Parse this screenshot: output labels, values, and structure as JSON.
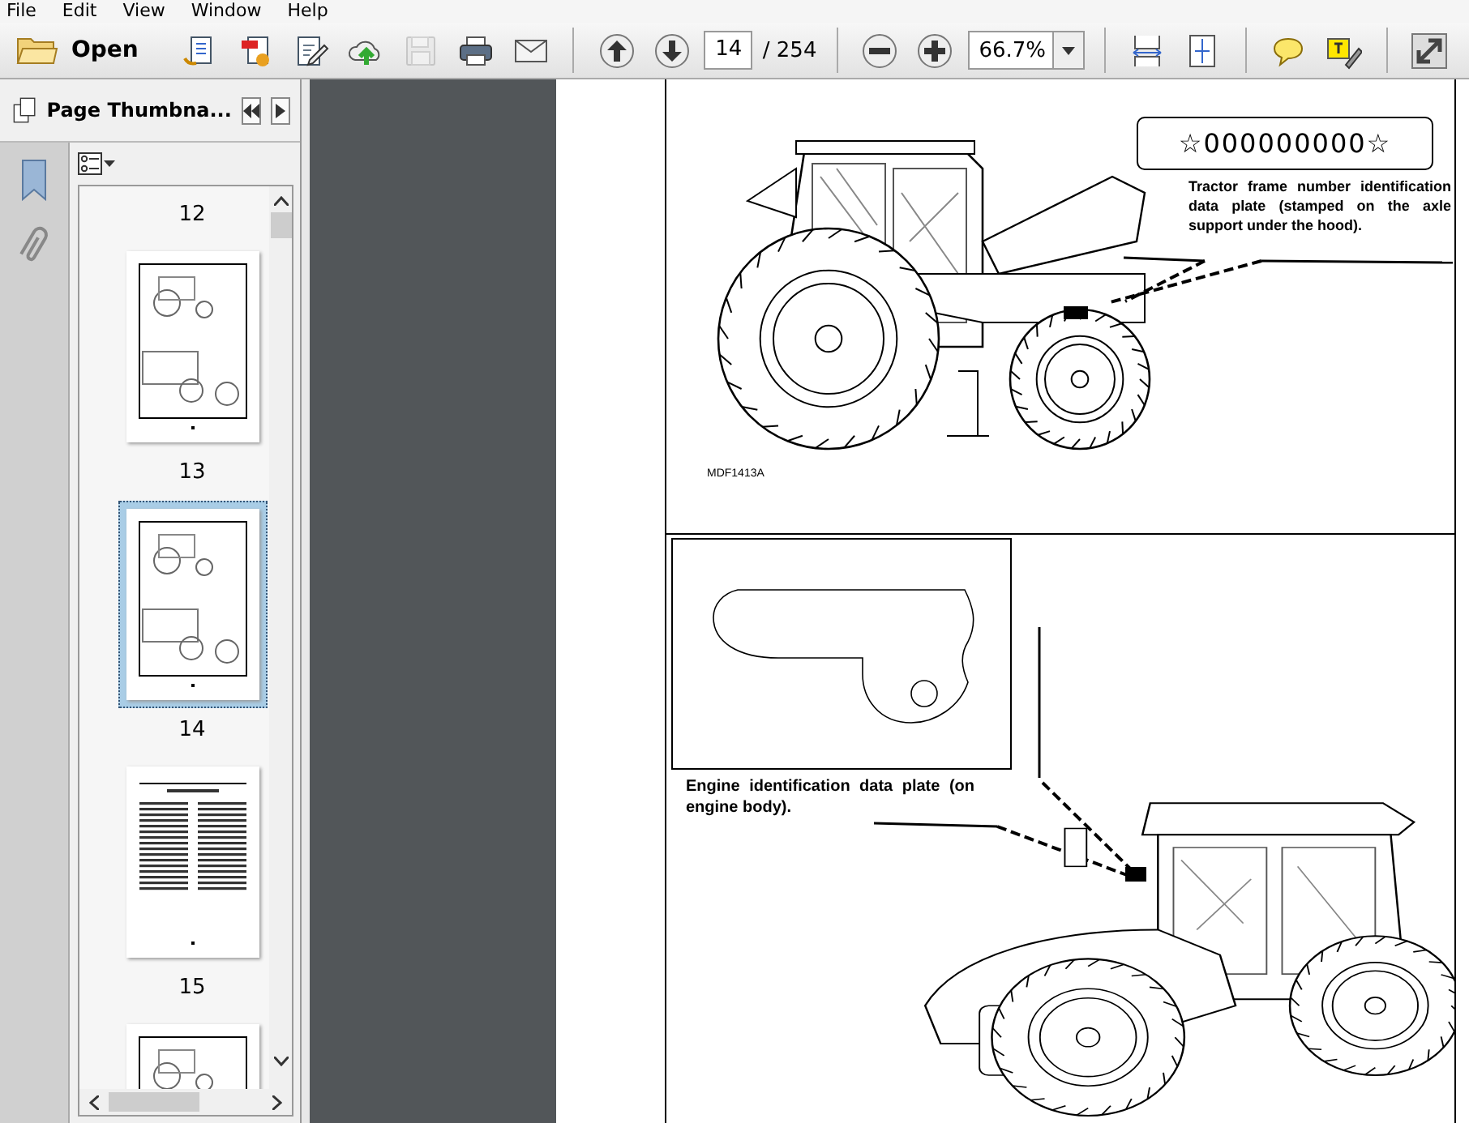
{
  "menu": [
    "File",
    "Edit",
    "View",
    "Window",
    "Help"
  ],
  "toolbar": [
    {
      "kind": "open",
      "label": "Open"
    },
    {
      "kind": "create",
      "disabled": false
    },
    {
      "kind": "convert",
      "disabled": false
    },
    {
      "kind": "edit",
      "disabled": false
    },
    {
      "kind": "upload",
      "disabled": false
    },
    {
      "kind": "save",
      "disabled": true
    },
    {
      "kind": "print",
      "disabled": false
    },
    {
      "kind": "mail",
      "disabled": false
    },
    {
      "kind": "separator"
    },
    {
      "kind": "prev",
      "disabled": false
    },
    {
      "kind": "next",
      "disabled": false
    },
    {
      "kind": "page",
      "value": "14",
      "total": "/ 254"
    },
    {
      "kind": "separator"
    },
    {
      "kind": "zoomout",
      "disabled": false
    },
    {
      "kind": "zoomin",
      "disabled": false
    },
    {
      "kind": "zoom",
      "value": "66.7%"
    },
    {
      "kind": "separator"
    },
    {
      "kind": "fitwidth",
      "disabled": false
    },
    {
      "kind": "fitpage",
      "disabled": false
    },
    {
      "kind": "separator"
    },
    {
      "kind": "comment",
      "disabled": false
    },
    {
      "kind": "highlight",
      "disabled": false
    },
    {
      "kind": "separator"
    },
    {
      "kind": "fullscreen",
      "disabled": false
    }
  ],
  "thumbnails_panel": {
    "title": "Page Thumbna...",
    "items": [
      {
        "kind": "label_only",
        "label": "12",
        "selected": false
      },
      {
        "kind": "figure",
        "label": "13",
        "selected": false
      },
      {
        "kind": "figure",
        "label": "14",
        "selected": true
      },
      {
        "kind": "text",
        "label": "15",
        "selected": false
      },
      {
        "kind": "thumb_only",
        "selected": false
      }
    ]
  },
  "document": {
    "plate_number": "☆000000000☆",
    "frame_caption": "Tractor frame number identification data plate (stamped on the axle support under the hood).",
    "figure_code": "MDF1413A",
    "engine_caption": "Engine identification data plate (on engine body)."
  }
}
